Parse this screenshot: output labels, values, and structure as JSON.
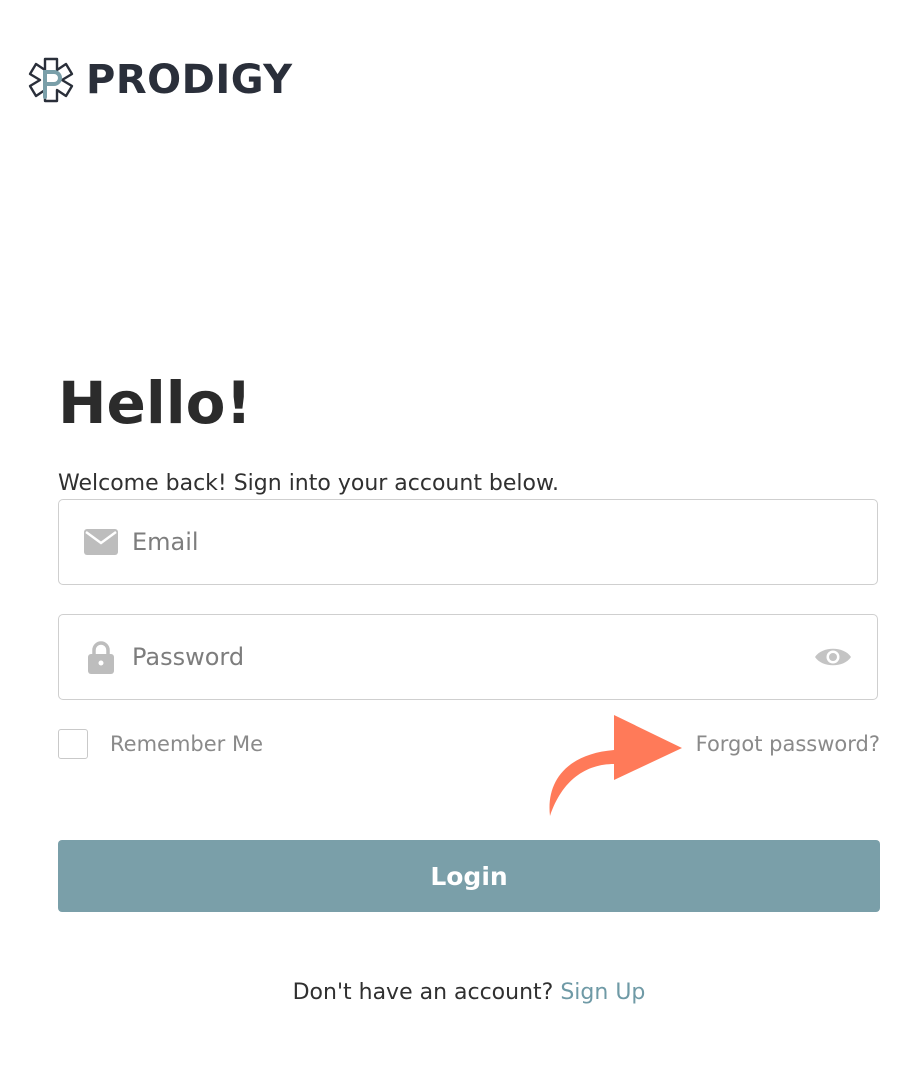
{
  "brand": {
    "name": "PRODIGY",
    "colors": {
      "dark": "#2a2f3a",
      "accent": "#7a9fa9"
    }
  },
  "main": {
    "heading": "Hello!",
    "subheading": "Welcome back! Sign into your account below."
  },
  "form": {
    "email": {
      "placeholder": "Email",
      "value": "",
      "icon": "mail-icon"
    },
    "password": {
      "placeholder": "Password",
      "value": "",
      "icon": "lock-icon",
      "toggle_icon": "eye-icon"
    },
    "remember_label": "Remember Me",
    "remember_checked": false,
    "forgot_label": "Forgot password?",
    "login_label": "Login",
    "annotation_arrow_color": "#ff7a59"
  },
  "footer": {
    "prompt": "Don't have an account?",
    "signup_label": "Sign Up"
  }
}
